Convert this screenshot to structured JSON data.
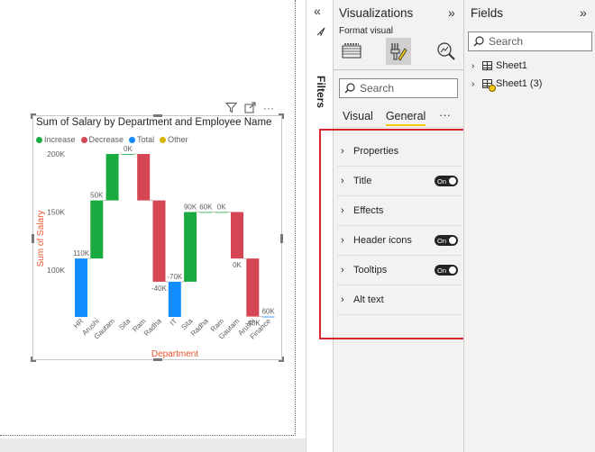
{
  "colors": {
    "increase": "#1aab40",
    "decrease": "#d64554",
    "total": "#118dff",
    "other": "#d9b300",
    "highlight": "#d9242f",
    "accent": "#f2c811"
  },
  "visual": {
    "header_icons": [
      "filter-icon",
      "focus-mode-icon",
      "more-options-icon"
    ],
    "title": "Sum of Salary by Department and Employee Name",
    "legend": [
      {
        "label": "Increase",
        "color": "#1aab40"
      },
      {
        "label": "Decrease",
        "color": "#d64554"
      },
      {
        "label": "Total",
        "color": "#118dff"
      },
      {
        "label": "Other",
        "color": "#d9b300"
      }
    ]
  },
  "chart_data": {
    "type": "waterfall",
    "title": "Sum of Salary by Department and Employee Name",
    "xlabel": "Department",
    "ylabel": "Sum of Salary",
    "y_ticks": [
      "200K",
      "150K",
      "100K"
    ],
    "ylim": [
      50000,
      205000
    ],
    "legend_position": "top-left",
    "grid": false,
    "categories": [
      "HR",
      "Arushi",
      "Gautam",
      "Sita",
      "Ram",
      "Radha",
      "IT",
      "Sita",
      "Radha",
      "Ram",
      "Gautam",
      "Arushi",
      "Finance"
    ],
    "bars": [
      {
        "category": "HR",
        "kind": "total",
        "start": 0,
        "end": 110000,
        "label": "110K"
      },
      {
        "category": "Arushi",
        "kind": "increase",
        "start": 110000,
        "end": 160000,
        "label": "50K"
      },
      {
        "category": "Gautam",
        "kind": "increase",
        "start": 160000,
        "end": 200000,
        "label": ""
      },
      {
        "category": "Sita",
        "kind": "increase",
        "start": 200000,
        "end": 200000,
        "label": "0K"
      },
      {
        "category": "Ram",
        "kind": "decrease",
        "start": 200000,
        "end": 160000,
        "label": ""
      },
      {
        "category": "Radha",
        "kind": "decrease",
        "start": 160000,
        "end": 90000,
        "label": "-40K"
      },
      {
        "category": "IT",
        "kind": "total",
        "start": 0,
        "end": 90000,
        "label": "-70K"
      },
      {
        "category": "Sita",
        "kind": "increase",
        "start": 90000,
        "end": 150000,
        "label": "90K"
      },
      {
        "category": "Radha",
        "kind": "increase",
        "start": 150000,
        "end": 150000,
        "label": "60K"
      },
      {
        "category": "Ram",
        "kind": "increase",
        "start": 150000,
        "end": 150000,
        "label": "0K"
      },
      {
        "category": "Gautam",
        "kind": "decrease",
        "start": 150000,
        "end": 110000,
        "label": "0K"
      },
      {
        "category": "Arushi",
        "kind": "decrease",
        "start": 110000,
        "end": 60000,
        "label": "-40K"
      },
      {
        "category": "Finance",
        "kind": "total",
        "start": 0,
        "end": 60000,
        "label": "60K"
      }
    ]
  },
  "filters_pane": {
    "label": "Filters"
  },
  "visualizations": {
    "title": "Visualizations",
    "format_visual": "Format visual",
    "search_placeholder": "Search",
    "tabs": [
      {
        "label": "Visual",
        "active": false
      },
      {
        "label": "General",
        "active": true
      }
    ],
    "sections": [
      {
        "label": "Properties",
        "toggle": null
      },
      {
        "label": "Title",
        "toggle": "On"
      },
      {
        "label": "Effects",
        "toggle": null
      },
      {
        "label": "Header icons",
        "toggle": "On"
      },
      {
        "label": "Tooltips",
        "toggle": "On"
      },
      {
        "label": "Alt text",
        "toggle": null
      }
    ]
  },
  "fields": {
    "title": "Fields",
    "search_placeholder": "Search",
    "tables": [
      {
        "label": "Sheet1",
        "checked": false
      },
      {
        "label": "Sheet1 (3)",
        "checked": true
      }
    ]
  }
}
